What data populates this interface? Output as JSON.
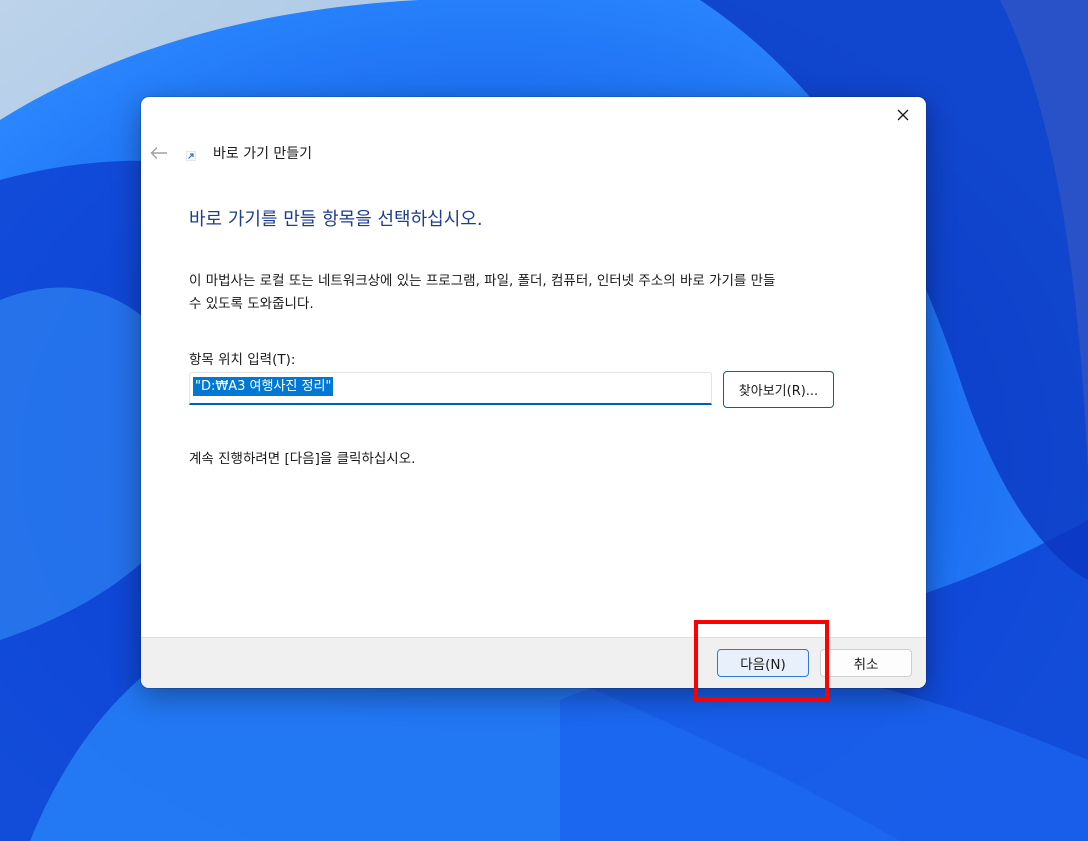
{
  "dialog": {
    "wizard_title": "바로 가기 만들기",
    "heading": "바로 가기를 만들 항목을 선택하십시오.",
    "description_lines": [
      "이 마법사는 로컬 또는 네트워크상에 있는 프로그램, 파일, 폴더, 컴퓨터, 인터넷 주소의 바로 가기를 만들",
      "수 있도록 도와줍니다."
    ],
    "location_label": "항목 위치 입력(T):",
    "location_value": "\"D:₩A3 여행사진 정리\"",
    "browse_label": "찾아보기(R)...",
    "continue_text": "계속 진행하려면 [다음]을 클릭하십시오.",
    "next_label": "다음(N)",
    "cancel_label": "취소"
  },
  "icons": {
    "close": "close-icon",
    "back": "back-arrow-icon",
    "wizard": "shortcut-arrow-icon"
  },
  "colors": {
    "accent": "#005fb8",
    "heading": "#1f3c8e",
    "selection": "#0078d4",
    "highlight": "#ff0000"
  }
}
